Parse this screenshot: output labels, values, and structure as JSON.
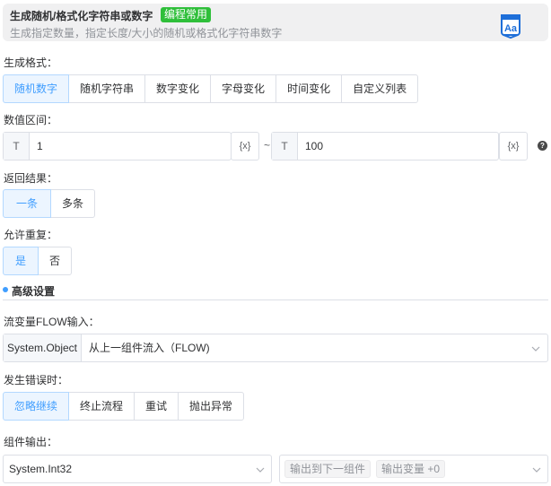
{
  "header": {
    "title": "生成随机/格式化字符串或数字",
    "tag": "编程常用",
    "subtitle": "生成指定数量，指定长度/大小的随机或格式化字符串数字",
    "icon": "font-aa-icon",
    "accent": "#1e6fd9"
  },
  "format": {
    "label": "生成格式：",
    "options": [
      "随机数字",
      "随机字符串",
      "数字变化",
      "字母变化",
      "时间变化",
      "自定义列表"
    ],
    "selected": "随机数字"
  },
  "range": {
    "label": "数值区间：",
    "min": {
      "prefix": "T",
      "value": "1",
      "var": "{x}"
    },
    "separator": "~",
    "max": {
      "prefix": "T",
      "value": "100",
      "var": "{x}"
    },
    "help": "?"
  },
  "result": {
    "label": "返回结果：",
    "options": [
      "一条",
      "多条"
    ],
    "selected": "一条"
  },
  "repeat": {
    "label": "允许重复：",
    "options": [
      "是",
      "否"
    ],
    "selected": "是"
  },
  "advanced": {
    "title": "高级设置"
  },
  "flow": {
    "label": "流变量FLOW输入：",
    "type": "System.Object",
    "value": "从上一组件流入（FLOW)"
  },
  "error": {
    "label": "发生错误时：",
    "options": [
      "忽略继续",
      "终止流程",
      "重试",
      "抛出异常"
    ],
    "selected": "忽略继续"
  },
  "output": {
    "label": "组件输出：",
    "type": "System.Int32",
    "tags": [
      "输出到下一组件",
      "输出变量 +0"
    ]
  },
  "colors": {
    "active_text": "#409eff",
    "active_bg": "#ecf5ff",
    "tag_green": "#2fbf3a"
  }
}
